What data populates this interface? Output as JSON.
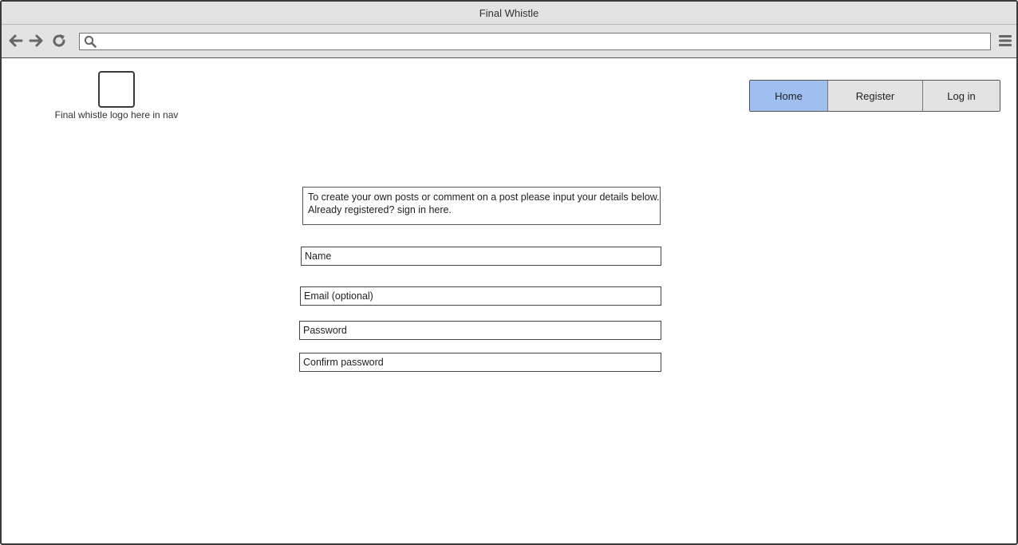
{
  "window": {
    "title": "Final Whistle"
  },
  "browser": {
    "icons": [
      "arrow-left-icon",
      "arrow-right-icon",
      "reload-icon",
      "search-icon",
      "hamburger-menu-icon"
    ],
    "address_value": ""
  },
  "header": {
    "logo_caption": "Final whistle logo here in nav",
    "nav": [
      {
        "label": "Home",
        "active": true
      },
      {
        "label": "Register",
        "active": false
      },
      {
        "label": "Log in",
        "active": false
      }
    ],
    "active_color": "#9fbff0"
  },
  "form": {
    "intro": "To create your own posts or comment on a post please input your details below. Already registered? sign in here.",
    "fields": [
      {
        "placeholder": "Name",
        "value": ""
      },
      {
        "placeholder": "Email (optional)",
        "value": ""
      },
      {
        "placeholder": "Password",
        "value": ""
      },
      {
        "placeholder": "Confirm password",
        "value": ""
      }
    ]
  }
}
